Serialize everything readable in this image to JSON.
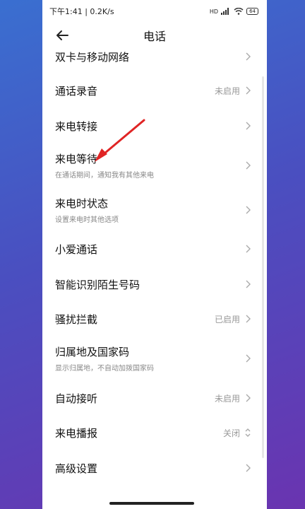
{
  "status": {
    "time_speed": "下午1:41 | 0.2K/s",
    "signal": "HD",
    "battery": "64"
  },
  "header": {
    "title": "电话",
    "back_icon": "back-arrow-icon"
  },
  "items": [
    {
      "label": "双卡与移动网络",
      "sub": "",
      "value": ""
    },
    {
      "label": "通话录音",
      "sub": "",
      "value": "未启用"
    },
    {
      "label": "来电转接",
      "sub": "",
      "value": ""
    },
    {
      "label": "来电等待",
      "sub": "在通话期间，通知我有其他来电",
      "value": ""
    },
    {
      "label": "来电时状态",
      "sub": "设置来电时其他选项",
      "value": ""
    },
    {
      "label": "小爱通话",
      "sub": "",
      "value": ""
    },
    {
      "label": "智能识别陌生号码",
      "sub": "",
      "value": ""
    },
    {
      "label": "骚扰拦截",
      "sub": "",
      "value": "已启用"
    },
    {
      "label": "归属地及国家码",
      "sub": "显示归属地，不自动加拨国家码",
      "value": ""
    },
    {
      "label": "自动接听",
      "sub": "",
      "value": "未启用"
    },
    {
      "label": "来电播报",
      "sub": "",
      "value": "关闭"
    },
    {
      "label": "高级设置",
      "sub": "",
      "value": ""
    }
  ],
  "colors": {
    "annotation_arrow": "#e02424"
  }
}
